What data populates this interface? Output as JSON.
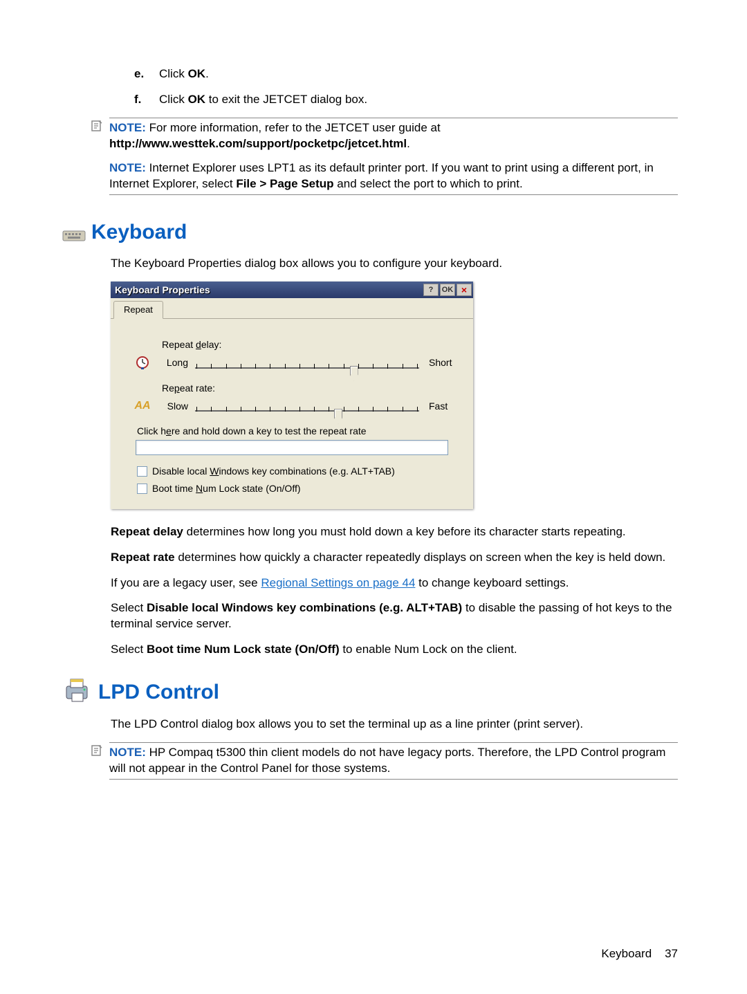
{
  "list": {
    "e": {
      "marker": "e.",
      "prefix": "Click ",
      "bold": "OK",
      "suffix": "."
    },
    "f": {
      "marker": "f.",
      "prefix": "Click ",
      "bold": "OK",
      "suffix": " to exit the JETCET dialog box."
    }
  },
  "note1": {
    "label": "NOTE:",
    "p1a": "For more information, refer to the JETCET user guide at ",
    "p1b": "http://www.westtek.com/support/pocketpc/jetcet.html",
    "p1c": ".",
    "p2a": "Internet Explorer uses LPT1 as its default printer port. If you want to print using a different port, in Internet Explorer, select ",
    "p2b": "File > Page Setup",
    "p2c": " and select the port to which to print."
  },
  "keyboard": {
    "heading": "Keyboard",
    "intro": "The Keyboard Properties dialog box allows you to configure your keyboard.",
    "dialog": {
      "title": "Keyboard Properties",
      "help": "?",
      "ok": "OK",
      "close": "×",
      "tab": "Repeat",
      "delay_label_pre": "Repeat ",
      "delay_underline": "d",
      "delay_label_post": "elay:",
      "delay_long": "Long",
      "delay_short": "Short",
      "rate_label_pre": "Re",
      "rate_underline": "p",
      "rate_label_post": "eat rate:",
      "rate_slow": "Slow",
      "rate_fast": "Fast",
      "test_label_pre": "Click h",
      "test_underline": "e",
      "test_label_post": "re and hold down a key to test the repeat rate",
      "cb1_pre": "Disable local ",
      "cb1_u": "W",
      "cb1_post": "indows key combinations (e.g. ALT+TAB)",
      "cb2_pre": "Boot time ",
      "cb2_u": "N",
      "cb2_post": "um Lock state (On/Off)"
    },
    "p_repeat_delay_b": "Repeat delay",
    "p_repeat_delay": " determines how long you must hold down a key before its character starts repeating.",
    "p_repeat_rate_b": "Repeat rate",
    "p_repeat_rate": " determines how quickly a character repeatedly displays on screen when the key is held down.",
    "p_legacy_a": "If you are a legacy user, see ",
    "p_legacy_link": "Regional Settings on page 44",
    "p_legacy_b": " to change keyboard settings.",
    "p_disable_a": "Select ",
    "p_disable_b": "Disable local Windows key combinations (e.g. ALT+TAB)",
    "p_disable_c": " to disable the passing of hot keys to the terminal service server.",
    "p_boot_a": "Select ",
    "p_boot_b": "Boot time Num Lock state (On/Off)",
    "p_boot_c": " to enable Num Lock on the client."
  },
  "lpd": {
    "heading": "LPD Control",
    "intro": "The LPD Control dialog box allows you to set the terminal up as a line printer (print server).",
    "note_label": "NOTE:",
    "note": "HP Compaq t5300 thin client models do not have legacy ports. Therefore, the LPD Control program will not appear in the Control Panel for those systems."
  },
  "footer": {
    "section": "Keyboard",
    "page": "37"
  }
}
